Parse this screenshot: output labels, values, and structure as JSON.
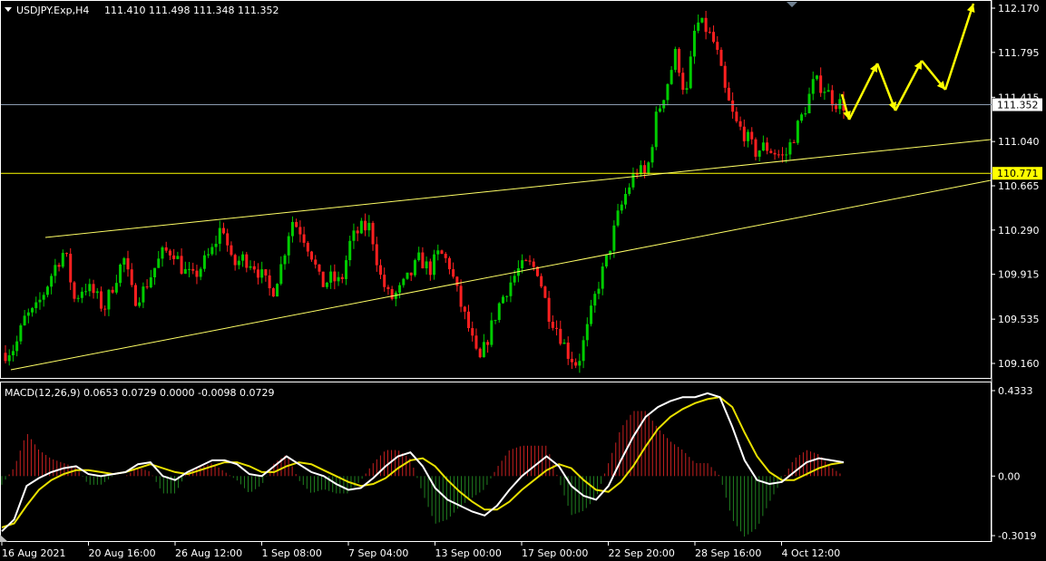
{
  "header": {
    "symbol": "USDJPY.Exp,H4",
    "ohlc": "111.410 111.498 111.348 111.352"
  },
  "macd_header": {
    "label": "MACD(12,26,9) 0.0653 0.0729 0.0000 -0.0098 0.0729"
  },
  "colors": {
    "background": "#000000",
    "bull_candle": "#00cc00",
    "bear_candle": "#ff2020",
    "trendline": "#ffff66",
    "horizontal_support": "#ffff00",
    "bid_line": "#8a9bb0",
    "projection_arrow": "#ffff00",
    "macd_line": "#ffffff",
    "signal_line": "#e8e000",
    "hist_pos": "#c82020",
    "hist_neg": "#208020",
    "panel_border": "#ffffff"
  },
  "price_axis": {
    "ticks": [
      "112.170",
      "111.795",
      "111.415",
      "111.040",
      "110.665",
      "110.290",
      "109.915",
      "109.535",
      "109.160"
    ],
    "current_price": "111.352",
    "support_price": "110.771"
  },
  "macd_axis": {
    "ticks": [
      "0.4333",
      "0.00",
      "-0.3019"
    ]
  },
  "time_axis": {
    "labels": [
      "16 Aug 2021",
      "20 Aug 16:00",
      "26 Aug 12:00",
      "1 Sep 08:00",
      "7 Sep 04:00",
      "13 Sep 00:00",
      "17 Sep 00:00",
      "22 Sep 20:00",
      "28 Sep 16:00",
      "4 Oct 12:00"
    ]
  },
  "chart_data": [
    {
      "type": "candlestick",
      "title": "USDJPY.Exp,H4",
      "ylim": [
        109.05,
        112.2
      ],
      "close_path": [
        109.25,
        109.3,
        109.55,
        109.6,
        109.78,
        109.98,
        110.12,
        109.7,
        109.82,
        109.75,
        109.62,
        109.85,
        110.05,
        109.7,
        109.78,
        109.95,
        110.1,
        110.12,
        109.95,
        109.88,
        110.0,
        110.12,
        110.35,
        109.98,
        110.05,
        110.02,
        109.9,
        109.75,
        110.0,
        110.38,
        110.28,
        110.1,
        109.82,
        109.88,
        109.84,
        110.2,
        110.3,
        110.32,
        109.9,
        109.7,
        109.78,
        109.9,
        110.05,
        109.95,
        110.1,
        110.0,
        109.7,
        109.45,
        109.15,
        109.4,
        109.65,
        109.82,
        109.95,
        110.0,
        109.95,
        109.6,
        109.45,
        109.25,
        109.15,
        109.45,
        109.8,
        110.05,
        110.38,
        110.62,
        110.8,
        110.75,
        111.25,
        111.5,
        111.8,
        111.4,
        112.05,
        112.0,
        111.85,
        111.45,
        111.2,
        111.1,
        110.95,
        111.0,
        110.95,
        110.9,
        111.1,
        111.3,
        111.55,
        111.5,
        111.38,
        111.35
      ]
    },
    {
      "type": "line",
      "title": "MACD(12,26,9)",
      "series": [
        {
          "values": [
            -0.28,
            -0.22,
            -0.05,
            -0.01,
            0.02,
            0.04,
            0.05,
            0.01,
            0.0,
            0.01,
            0.02,
            0.06,
            0.07,
            0.0,
            -0.02,
            0.02,
            0.05,
            0.08,
            0.08,
            0.06,
            0.01,
            0.0,
            0.05,
            0.1,
            0.06,
            0.02,
            0.0,
            -0.04,
            -0.07,
            -0.06,
            -0.01,
            0.05,
            0.1,
            0.12,
            0.05,
            -0.06,
            -0.12,
            -0.15,
            -0.18,
            -0.2,
            -0.15,
            -0.07,
            0.0,
            0.05,
            0.1,
            0.05,
            -0.05,
            -0.1,
            -0.12,
            -0.05,
            0.08,
            0.2,
            0.3,
            0.35,
            0.38,
            0.4,
            0.4,
            0.42,
            0.4,
            0.25,
            0.08,
            -0.02,
            -0.04,
            -0.03,
            0.02,
            0.07,
            0.09,
            0.08,
            0.07
          ]
        },
        {
          "values": [
            -0.26,
            -0.24,
            -0.15,
            -0.07,
            -0.02,
            0.01,
            0.03,
            0.03,
            0.02,
            0.01,
            0.02,
            0.04,
            0.06,
            0.04,
            0.02,
            0.01,
            0.03,
            0.05,
            0.07,
            0.07,
            0.05,
            0.02,
            0.02,
            0.05,
            0.07,
            0.06,
            0.03,
            0.0,
            -0.03,
            -0.05,
            -0.04,
            -0.01,
            0.04,
            0.08,
            0.09,
            0.05,
            -0.02,
            -0.08,
            -0.13,
            -0.17,
            -0.17,
            -0.13,
            -0.07,
            -0.02,
            0.03,
            0.06,
            0.04,
            -0.02,
            -0.07,
            -0.08,
            -0.03,
            0.05,
            0.15,
            0.24,
            0.3,
            0.34,
            0.37,
            0.39,
            0.4,
            0.35,
            0.22,
            0.1,
            0.02,
            -0.02,
            -0.02,
            0.01,
            0.04,
            0.06,
            0.07
          ]
        }
      ]
    }
  ]
}
